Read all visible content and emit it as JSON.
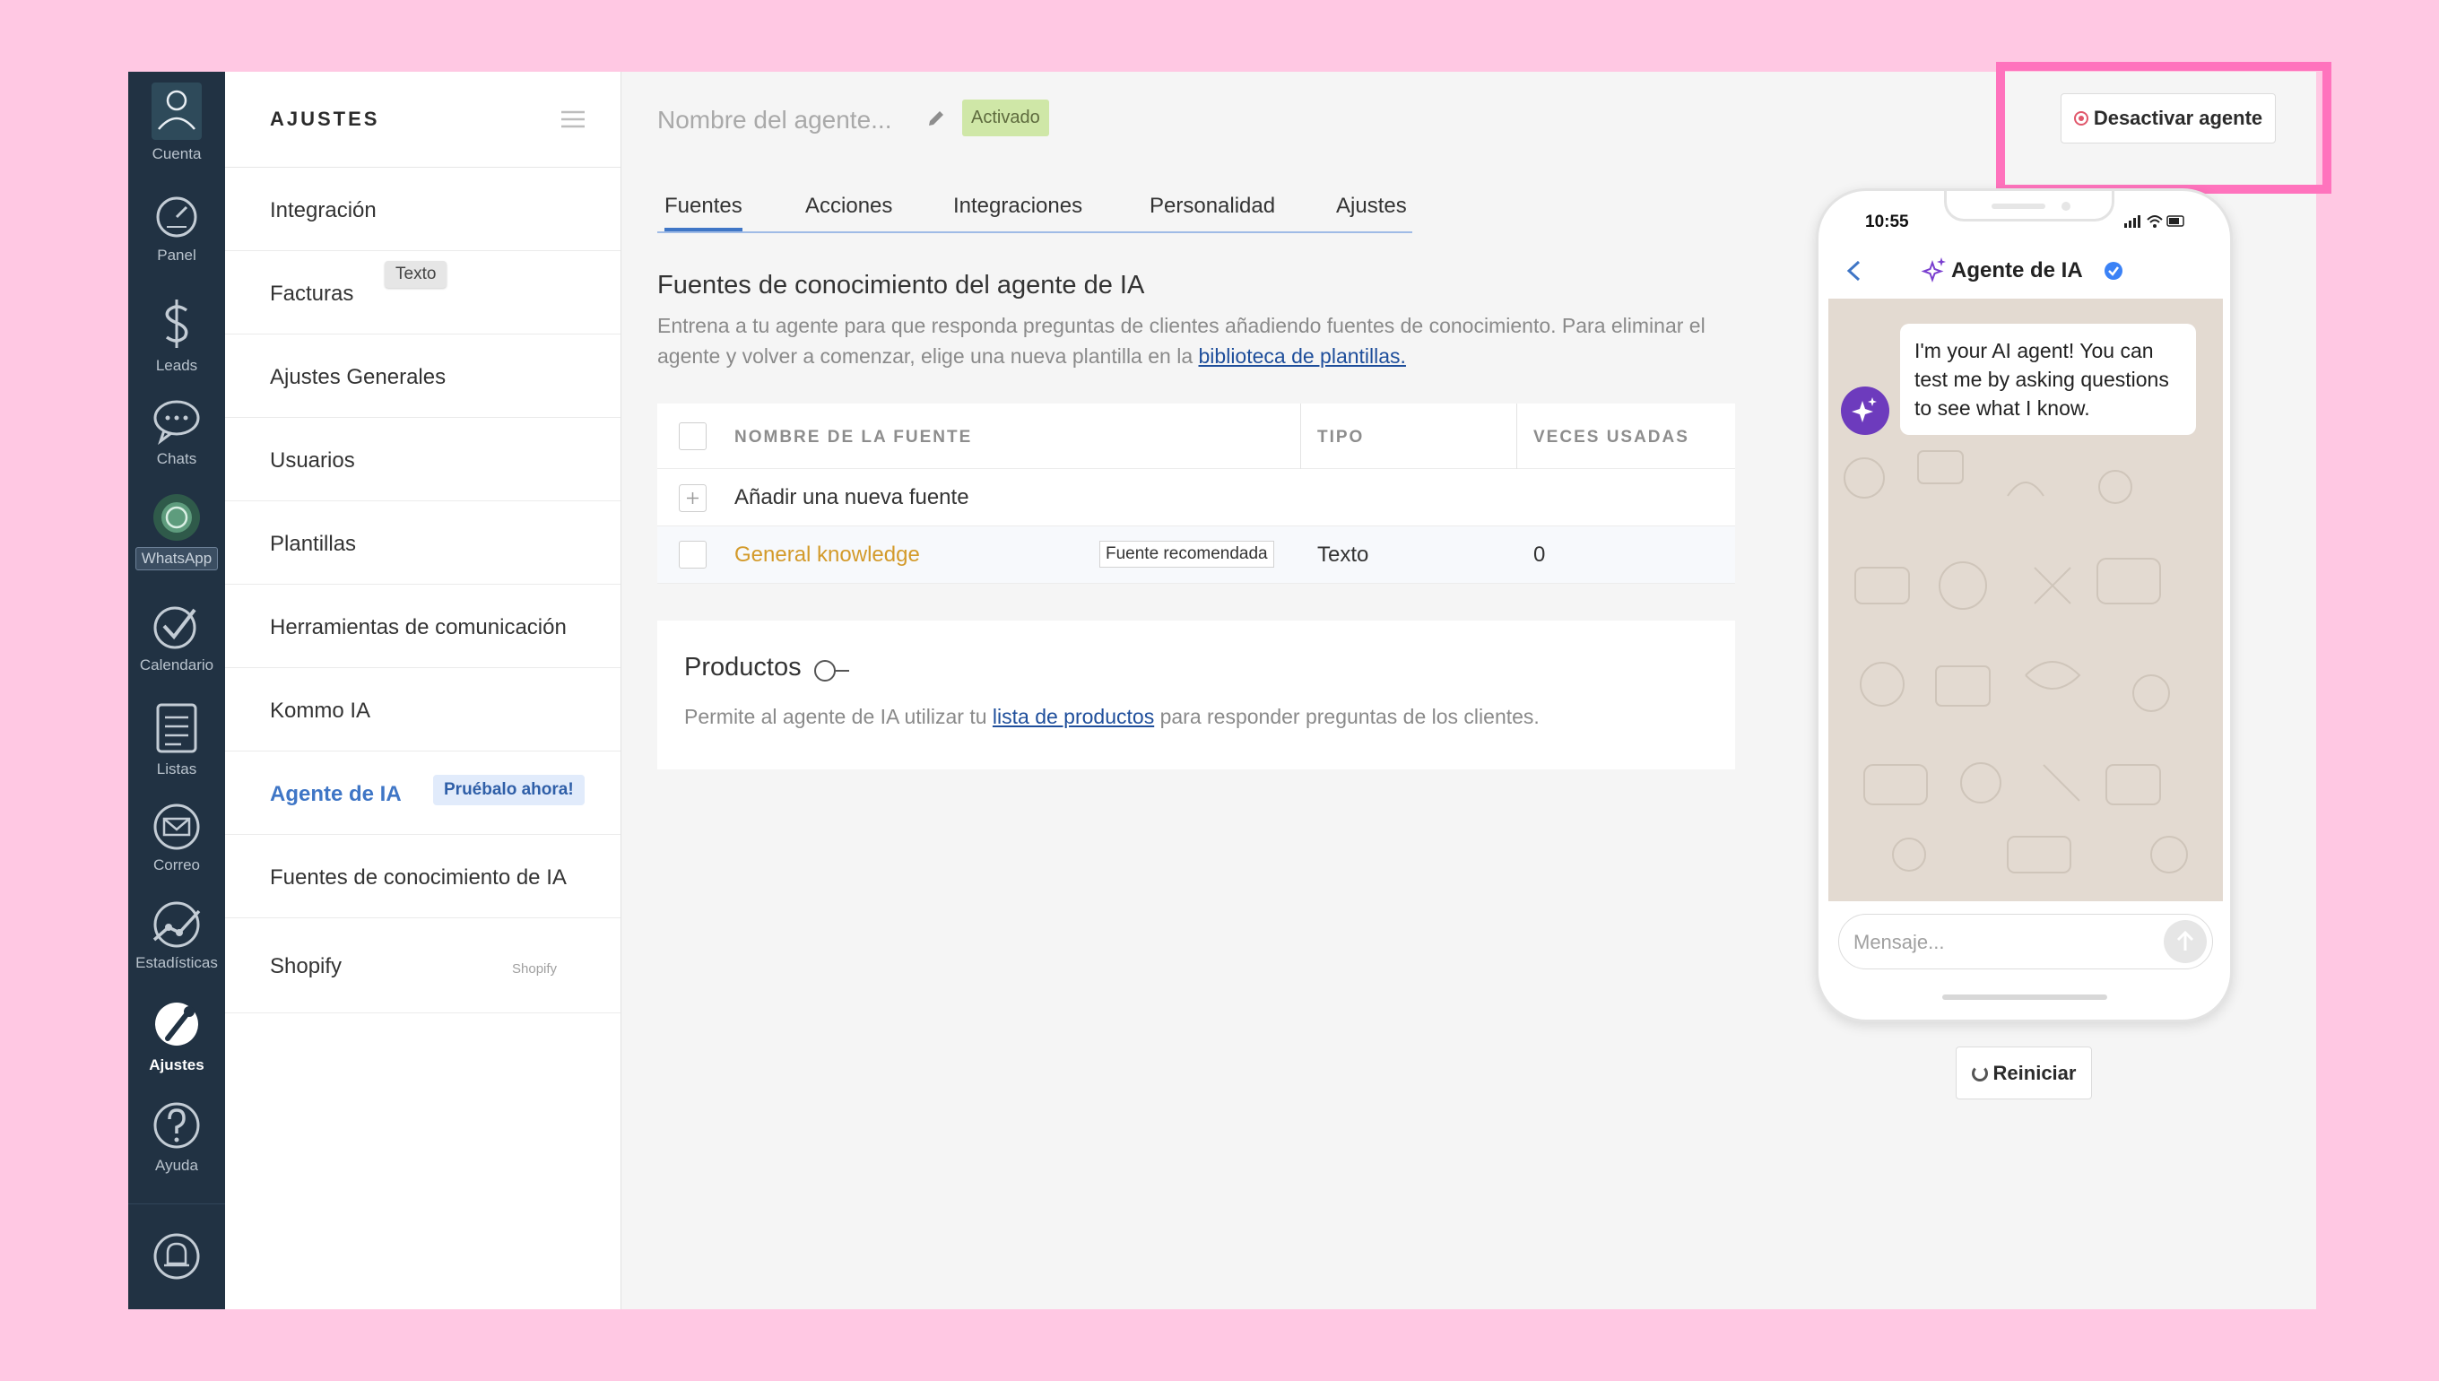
{
  "nav": {
    "items": [
      {
        "label": "Cuenta",
        "icon": "avatar-icon"
      },
      {
        "label": "Panel",
        "icon": "speedometer-icon"
      },
      {
        "label": "Leads",
        "icon": "dollar-icon"
      },
      {
        "label": "Chats",
        "icon": "chat-icon"
      },
      {
        "label": "WhatsApp",
        "icon": "whatsapp-icon"
      },
      {
        "label": "Calendario",
        "icon": "check-circle-icon"
      },
      {
        "label": "Listas",
        "icon": "list-icon"
      },
      {
        "label": "Correo",
        "icon": "mail-icon"
      },
      {
        "label": "Estadísticas",
        "icon": "stats-icon"
      },
      {
        "label": "Ajustes",
        "icon": "wrench-icon"
      },
      {
        "label": "Ayuda",
        "icon": "help-icon"
      }
    ],
    "bottom_icon": "bell-icon"
  },
  "settings": {
    "title": "AJUSTES",
    "items": [
      {
        "label": "Integración"
      },
      {
        "label": "Facturas",
        "tooltip": "Texto"
      },
      {
        "label": "Ajustes Generales"
      },
      {
        "label": "Usuarios"
      },
      {
        "label": "Plantillas"
      },
      {
        "label": "Herramientas de comunicación"
      },
      {
        "label": "Kommo IA"
      },
      {
        "label": "Agente de IA",
        "badge": "Pruébalo ahora!"
      },
      {
        "label": "Fuentes de conocimiento de IA"
      },
      {
        "label": "Shopify",
        "small": "Shopify"
      }
    ]
  },
  "agent": {
    "name_placeholder": "Nombre del agente...",
    "status": "Activado",
    "deactivate_label": "Desactivar agente"
  },
  "tabs": [
    "Fuentes",
    "Acciones",
    "Integraciones",
    "Personalidad",
    "Ajustes"
  ],
  "knowledge": {
    "title": "Fuentes de conocimiento del agente de IA",
    "desc_pre": "Entrena a tu agente para que responda preguntas de clientes añadiendo fuentes de conocimiento. Para eliminar el agente y volver a comenzar, elige una nueva plantilla en la ",
    "desc_link": "biblioteca de plantillas."
  },
  "table": {
    "headers": [
      "NOMBRE DE LA FUENTE",
      "TIPO",
      "VECES USADAS"
    ],
    "add_label": "Añadir una nueva fuente",
    "rows": [
      {
        "name": "General knowledge",
        "tag": "Fuente recomendada",
        "type": "Texto",
        "uses": "0"
      }
    ]
  },
  "products": {
    "title": "Productos",
    "desc_pre": "Permite al agente de IA utilizar tu ",
    "desc_link": "lista de productos",
    "desc_post": " para responder preguntas de los clientes."
  },
  "phone": {
    "time": "10:55",
    "title": "Agente de IA",
    "bubble": "I'm your AI agent! You can test me by asking questions to see what I know.",
    "input_placeholder": "Mensaje..."
  },
  "restart_label": "Reiniciar",
  "colors": {
    "accent": "#3f76c6",
    "nav_bg": "#213243",
    "status_bg": "#cfe7a7",
    "highlight": "#ff73bd",
    "source_link": "#d39a2a"
  }
}
